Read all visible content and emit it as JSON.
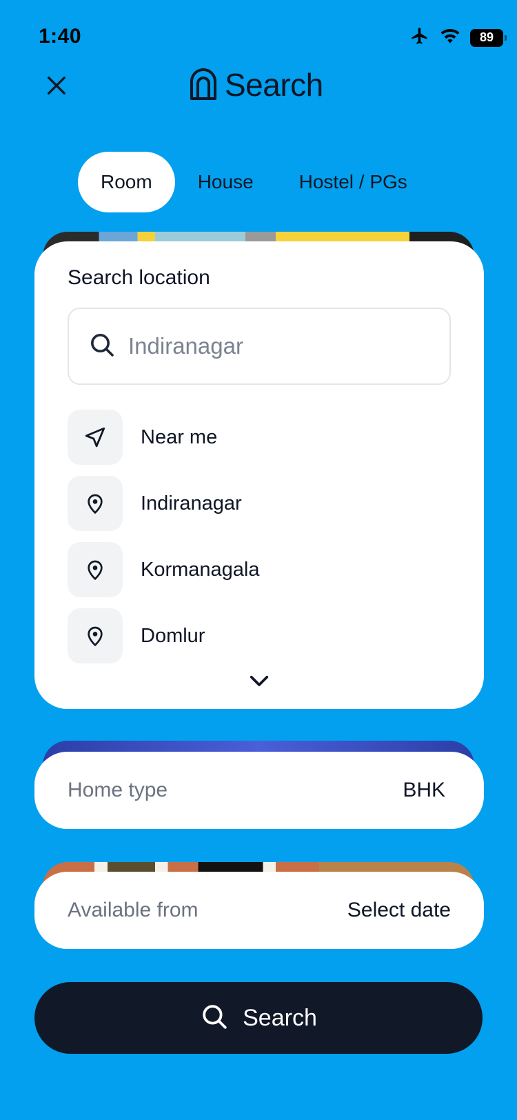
{
  "status_bar": {
    "time": "1:40",
    "battery": "89",
    "icons": [
      "airplane-icon",
      "wifi-icon",
      "battery-icon"
    ]
  },
  "header": {
    "title": "Search",
    "close_icon": "close-icon",
    "logo_icon": "arch-logo-icon"
  },
  "tabs": [
    {
      "label": "Room",
      "active": true
    },
    {
      "label": "House",
      "active": false
    },
    {
      "label": "Hostel / PGs",
      "active": false
    }
  ],
  "location": {
    "title": "Search location",
    "search_placeholder": "Indiranagar",
    "items": [
      {
        "label": "Near me",
        "icon": "navigation-arrow-icon"
      },
      {
        "label": "Indiranagar",
        "icon": "map-pin-icon"
      },
      {
        "label": "Kormanagala",
        "icon": "map-pin-icon"
      },
      {
        "label": "Domlur",
        "icon": "map-pin-icon"
      }
    ],
    "expand_icon": "chevron-down-icon"
  },
  "home_type": {
    "label": "Home type",
    "value": "BHK"
  },
  "available_from": {
    "label": "Available from",
    "value": "Select date"
  },
  "search_button": {
    "label": "Search",
    "icon": "search-icon"
  },
  "colors": {
    "background": "#02A0EE",
    "card": "#FFFFFF",
    "button": "#111827",
    "text_primary": "#0F1626",
    "text_secondary": "#6B7280"
  }
}
